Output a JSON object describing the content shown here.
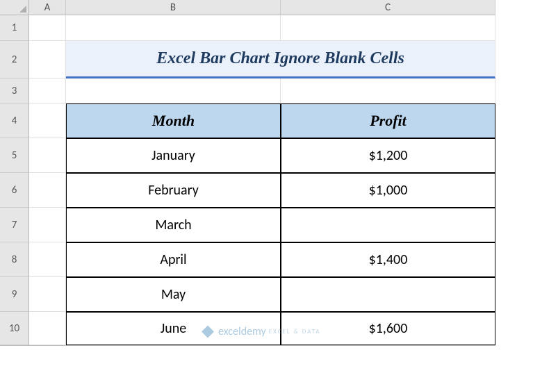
{
  "columns": {
    "A": "A",
    "B": "B",
    "C": "C"
  },
  "rows": {
    "1": "1",
    "2": "2",
    "3": "3",
    "4": "4",
    "5": "5",
    "6": "6",
    "7": "7",
    "8": "8",
    "9": "9",
    "10": "10"
  },
  "title": "Excel Bar Chart Ignore Blank Cells",
  "headers": {
    "month": "Month",
    "profit": "Profit"
  },
  "data": [
    {
      "month": "January",
      "profit": "$1,200"
    },
    {
      "month": "February",
      "profit": "$1,000"
    },
    {
      "month": "March",
      "profit": ""
    },
    {
      "month": "April",
      "profit": "$1,400"
    },
    {
      "month": "May",
      "profit": ""
    },
    {
      "month": "June",
      "profit": "$1,600"
    }
  ],
  "watermark": {
    "brand": "exceldemy",
    "tag": "EXCEL & DATA"
  },
  "chart_data": {
    "type": "bar",
    "title": "Excel Bar Chart Ignore Blank Cells",
    "xlabel": "Month",
    "ylabel": "Profit",
    "categories": [
      "January",
      "February",
      "March",
      "April",
      "May",
      "June"
    ],
    "values": [
      1200,
      1000,
      null,
      1400,
      null,
      1600
    ],
    "ylim": [
      0,
      2000
    ]
  }
}
